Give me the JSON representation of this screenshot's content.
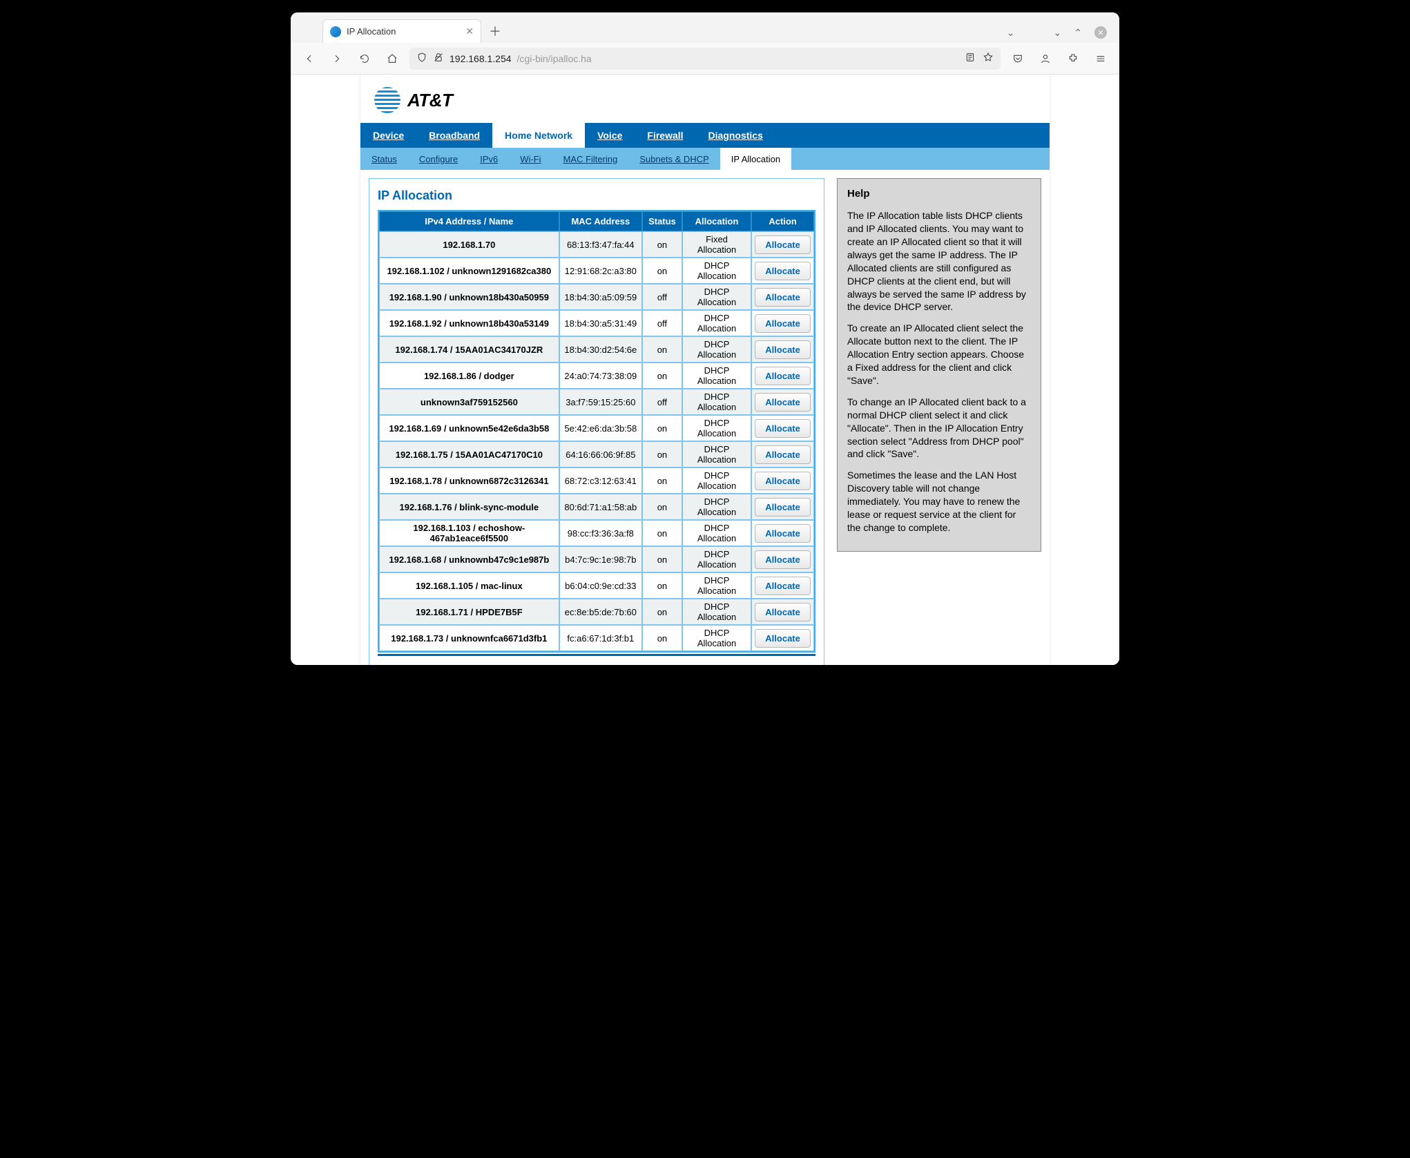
{
  "browser": {
    "tab_title": "IP Allocation",
    "url_host": "192.168.1.254",
    "url_path": "/cgi-bin/ipalloc.ha"
  },
  "brand": {
    "name": "AT&T"
  },
  "mainnav": {
    "items": [
      {
        "label": "Device"
      },
      {
        "label": "Broadband"
      },
      {
        "label": "Home Network",
        "active": true
      },
      {
        "label": "Voice"
      },
      {
        "label": "Firewall"
      },
      {
        "label": "Diagnostics"
      }
    ]
  },
  "subnav": {
    "items": [
      {
        "label": "Status"
      },
      {
        "label": "Configure"
      },
      {
        "label": "IPv6"
      },
      {
        "label": "Wi-Fi"
      },
      {
        "label": "MAC Filtering"
      },
      {
        "label": "Subnets & DHCP"
      },
      {
        "label": "IP Allocation",
        "active": true
      }
    ]
  },
  "page": {
    "title": "IP Allocation",
    "columns": {
      "name": "IPv4 Address / Name",
      "mac": "MAC Address",
      "status": "Status",
      "allocation": "Allocation",
      "action": "Action"
    },
    "action_label": "Allocate",
    "rows": [
      {
        "name": "192.168.1.70",
        "mac": "68:13:f3:47:fa:44",
        "status": "on",
        "allocation": "Fixed Allocation"
      },
      {
        "name": "192.168.1.102 / unknown1291682ca380",
        "mac": "12:91:68:2c:a3:80",
        "status": "on",
        "allocation": "DHCP Allocation"
      },
      {
        "name": "192.168.1.90 / unknown18b430a50959",
        "mac": "18:b4:30:a5:09:59",
        "status": "off",
        "allocation": "DHCP Allocation"
      },
      {
        "name": "192.168.1.92 / unknown18b430a53149",
        "mac": "18:b4:30:a5:31:49",
        "status": "off",
        "allocation": "DHCP Allocation"
      },
      {
        "name": "192.168.1.74 / 15AA01AC34170JZR",
        "mac": "18:b4:30:d2:54:6e",
        "status": "on",
        "allocation": "DHCP Allocation"
      },
      {
        "name": "192.168.1.86 / dodger",
        "mac": "24:a0:74:73:38:09",
        "status": "on",
        "allocation": "DHCP Allocation"
      },
      {
        "name": "unknown3af759152560",
        "mac": "3a:f7:59:15:25:60",
        "status": "off",
        "allocation": "DHCP Allocation"
      },
      {
        "name": "192.168.1.69 / unknown5e42e6da3b58",
        "mac": "5e:42:e6:da:3b:58",
        "status": "on",
        "allocation": "DHCP Allocation"
      },
      {
        "name": "192.168.1.75 / 15AA01AC47170C10",
        "mac": "64:16:66:06:9f:85",
        "status": "on",
        "allocation": "DHCP Allocation"
      },
      {
        "name": "192.168.1.78 / unknown6872c3126341",
        "mac": "68:72:c3:12:63:41",
        "status": "on",
        "allocation": "DHCP Allocation"
      },
      {
        "name": "192.168.1.76 / blink-sync-module",
        "mac": "80:6d:71:a1:58:ab",
        "status": "on",
        "allocation": "DHCP Allocation"
      },
      {
        "name": "192.168.1.103 / echoshow-467ab1eace6f5500",
        "mac": "98:cc:f3:36:3a:f8",
        "status": "on",
        "allocation": "DHCP Allocation"
      },
      {
        "name": "192.168.1.68 / unknownb47c9c1e987b",
        "mac": "b4:7c:9c:1e:98:7b",
        "status": "on",
        "allocation": "DHCP Allocation"
      },
      {
        "name": "192.168.1.105 / mac-linux",
        "mac": "b6:04:c0:9e:cd:33",
        "status": "on",
        "allocation": "DHCP Allocation"
      },
      {
        "name": "192.168.1.71 / HPDE7B5F",
        "mac": "ec:8e:b5:de:7b:60",
        "status": "on",
        "allocation": "DHCP Allocation"
      },
      {
        "name": "192.168.1.73 / unknownfca6671d3fb1",
        "mac": "fc:a6:67:1d:3f:b1",
        "status": "on",
        "allocation": "DHCP Allocation"
      }
    ]
  },
  "help": {
    "title": "Help",
    "paragraphs": [
      "The IP Allocation table lists DHCP clients and IP Allocated clients. You may want to create an IP Allocated client so that it will always get the same IP address. The IP Allocated clients are still configured as DHCP clients at the client end, but will always be served the same IP address by the device DHCP server.",
      "To create an IP Allocated client select the Allocate button next to the client. The IP Allocation Entry section appears. Choose a Fixed address for the client and click \"Save\".",
      "To change an IP Allocated client back to a normal DHCP client select it and click \"Allocate\". Then in the IP Allocation Entry section select \"Address from DHCP pool\" and click \"Save\".",
      "Sometimes the lease and the LAN Host Discovery table will not change immediately. You may have to renew the lease or request service at the client for the change to complete."
    ]
  }
}
